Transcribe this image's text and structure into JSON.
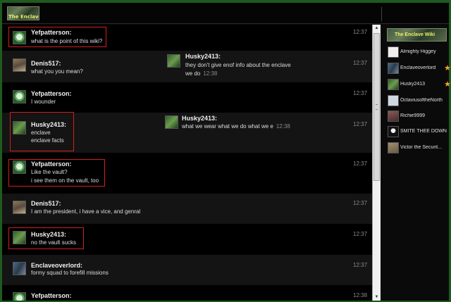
{
  "header": {
    "logo_text": "The Enclave Wiki"
  },
  "sidebar": {
    "logo_text": "The Enclave Wiki",
    "users": [
      {
        "name": "Almighty Higgey",
        "star": false,
        "avatar": "person-avatar"
      },
      {
        "name": "Enclaveoverlord",
        "star": true,
        "avatar": "enclave-avatar"
      },
      {
        "name": "Husky2413",
        "star": true,
        "avatar": "husky-avatar"
      },
      {
        "name": "OctaviusoftheNorth",
        "star": false,
        "avatar": "person-avatar"
      },
      {
        "name": "Richie9999",
        "star": false,
        "avatar": "person-avatar"
      },
      {
        "name": "SMITE THEE DOWN",
        "star": false,
        "avatar": "person-avatar"
      },
      {
        "name": "Victor the Securit...",
        "star": false,
        "avatar": "person-avatar"
      }
    ]
  },
  "messages": [
    {
      "user": "Yefpatterson:",
      "lines": [
        "what is the point of this wiki?"
      ],
      "time": "12:37",
      "inline": null
    },
    {
      "user": "Denis517:",
      "lines": [
        "what you you mean?"
      ],
      "time": "12:37",
      "inline": {
        "user": "Husky2413:",
        "lines": [
          "they don't give enof info about the enclave",
          "we do"
        ],
        "time": "12:38"
      }
    },
    {
      "user": "Yefpatterson:",
      "lines": [
        "I wounder"
      ],
      "time": "12:37",
      "inline": null
    },
    {
      "user": "Husky2413:",
      "lines": [
        "enclave",
        "enclave facts"
      ],
      "time": "12:37",
      "inline": {
        "user": "Husky2413:",
        "lines": [
          "what we wear what we do what we e"
        ],
        "time": "12:38"
      }
    },
    {
      "user": "Yefpatterson:",
      "lines": [
        "Like the vault?",
        "i see them on the vault, too"
      ],
      "time": "12:37",
      "inline": null
    },
    {
      "user": "Denis517:",
      "lines": [
        "I am the president, i have a vice, and genral"
      ],
      "time": "12:37",
      "inline": null
    },
    {
      "user": "Husky2413:",
      "lines": [
        "no the vault sucks"
      ],
      "time": "12:37",
      "inline": null
    },
    {
      "user": "Enclaveoverlord:",
      "lines": [
        "formy squad to forefill missions"
      ],
      "time": "12:37",
      "inline": null
    },
    {
      "user": "Yefpatterson:",
      "lines": [
        ""
      ],
      "time": "12:38",
      "inline": null
    }
  ],
  "icons": {
    "star": "★",
    "scroll_up": "▲",
    "scroll_down": "▼"
  }
}
